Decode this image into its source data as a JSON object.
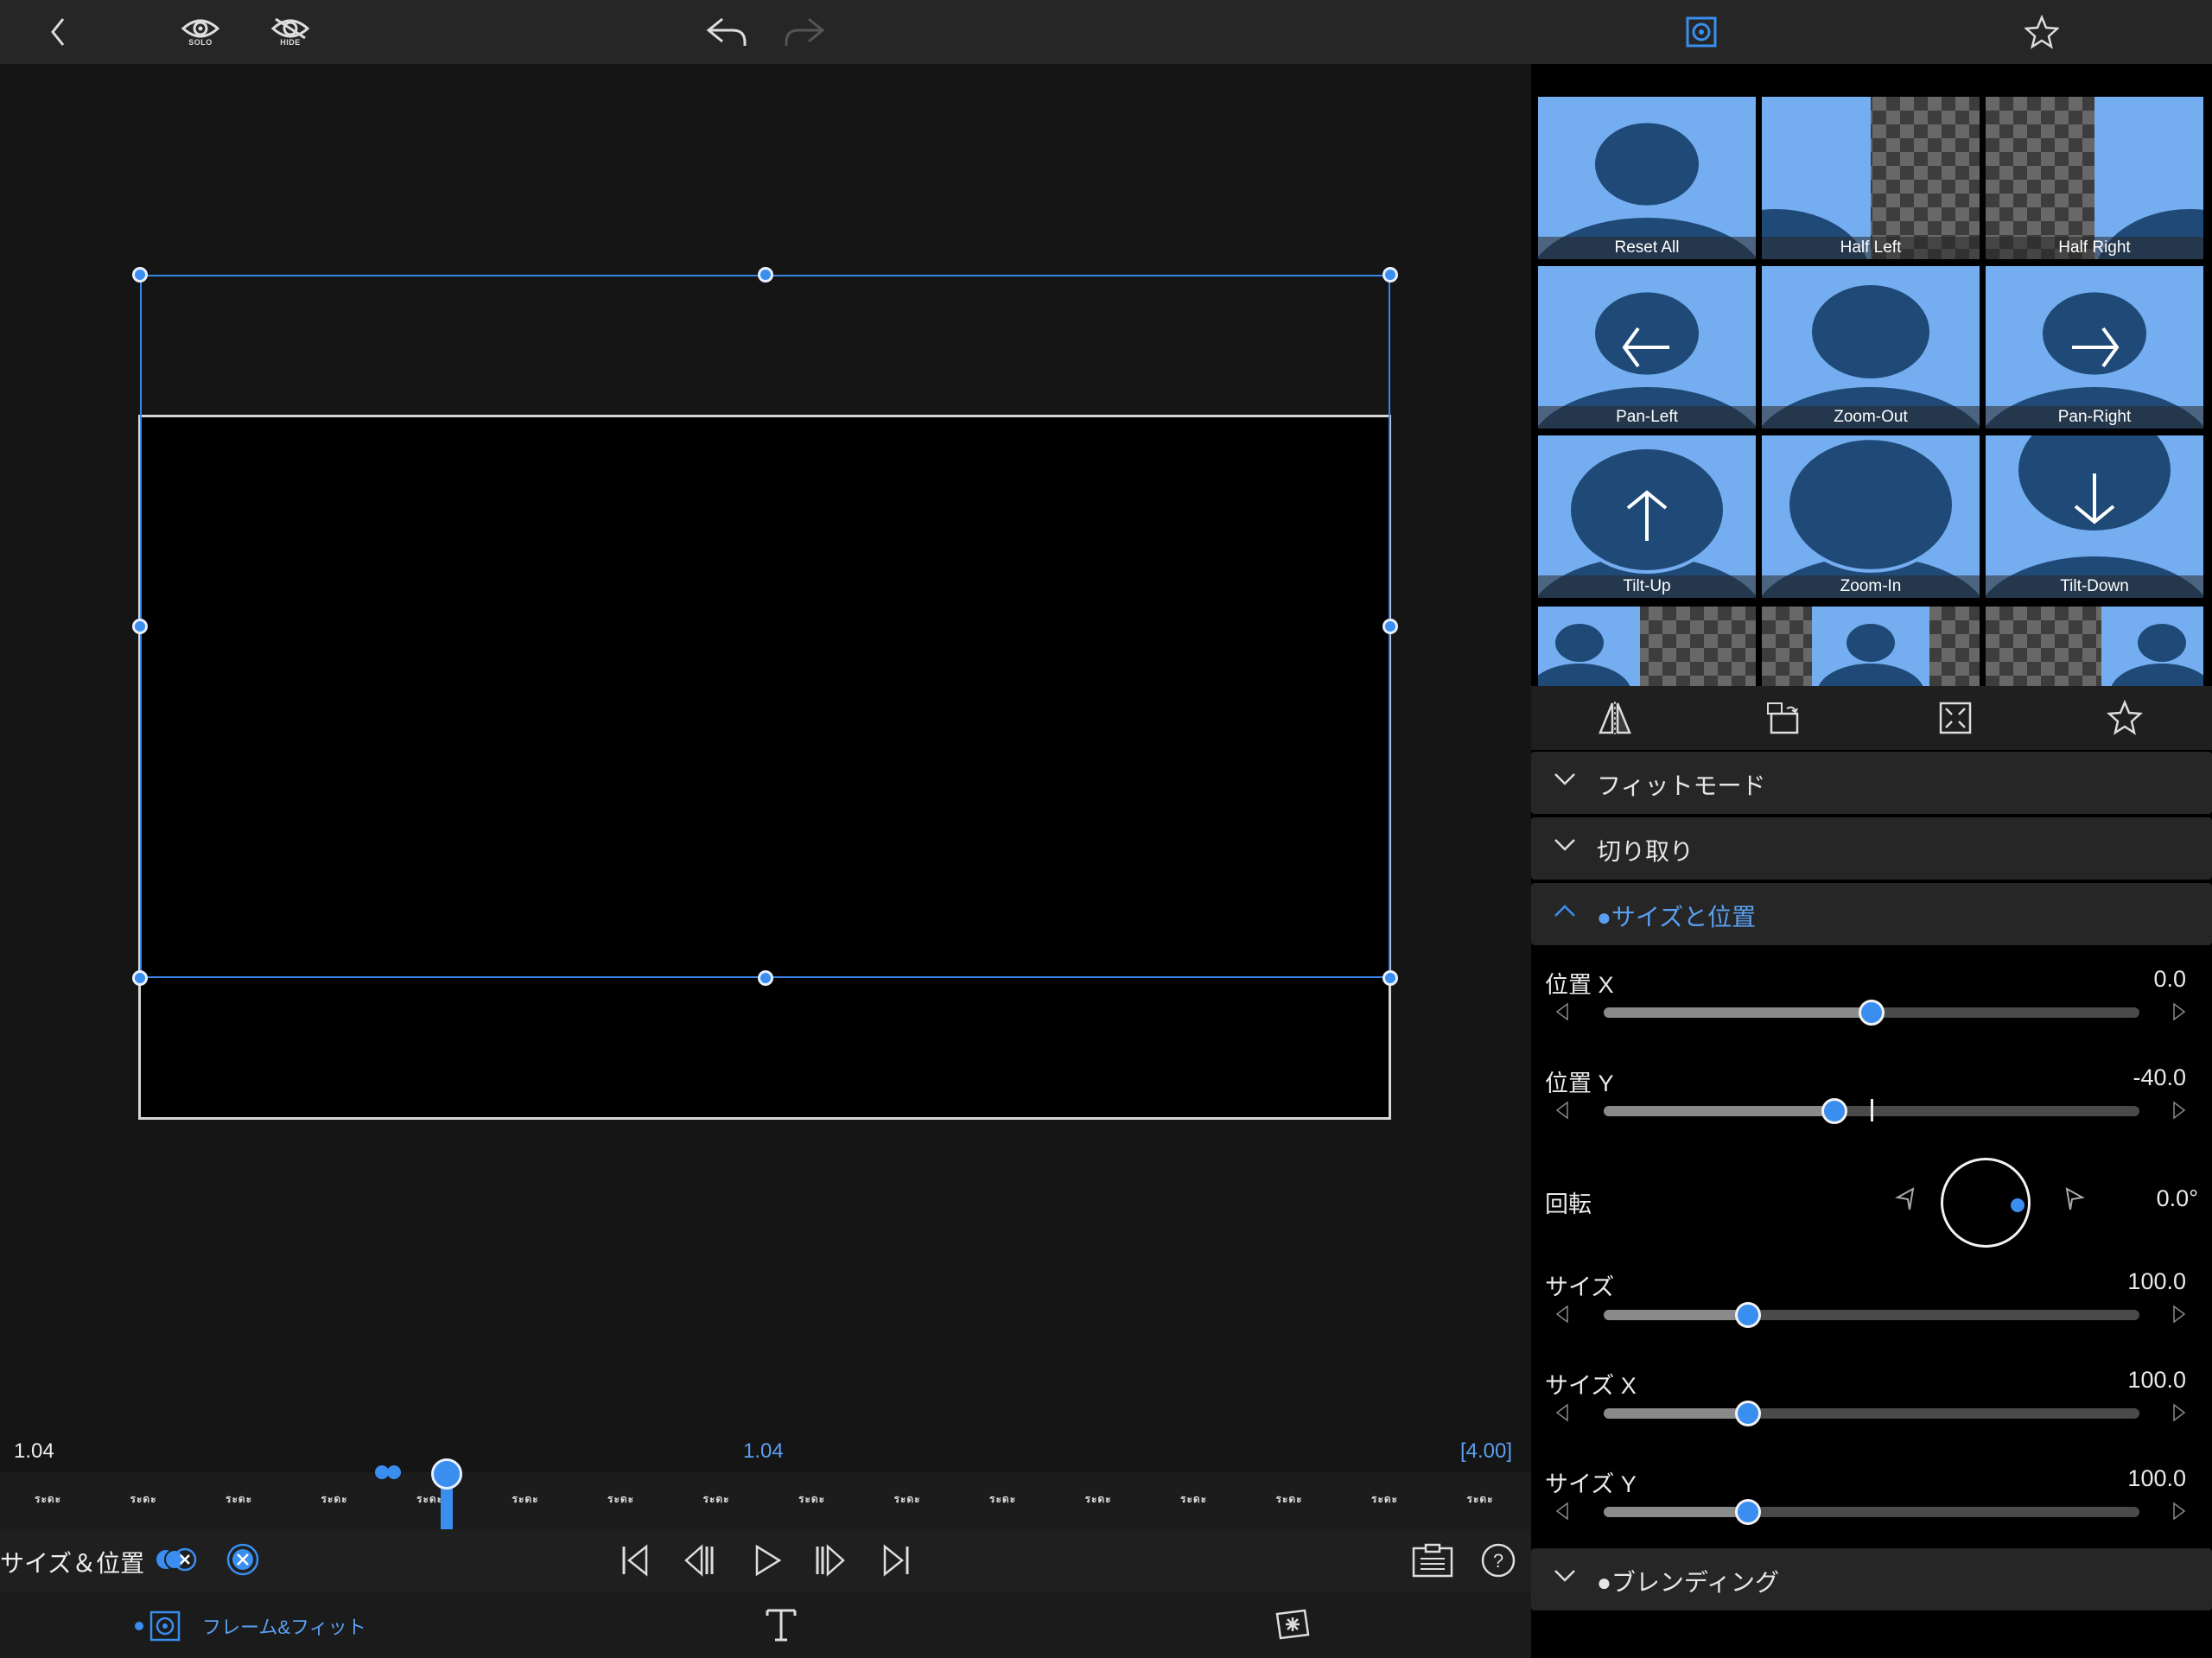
{
  "toolbar": {
    "solo_label": "SOLO",
    "hide_label": "HIDE",
    "icons": [
      "back-chevron-icon",
      "eye-icon",
      "eye-slash-icon",
      "undo-icon",
      "redo-icon",
      "frame-fit-icon",
      "star-icon"
    ]
  },
  "timeline": {
    "current_left": "1.04",
    "current_center": "1.04",
    "duration": "[4.00]",
    "tick_label": "ระดะ",
    "tick_count": 16
  },
  "transport": {
    "mode_label": "サイズ＆位置",
    "icons": [
      "keyframe-toggle-icon",
      "clear-icon",
      "go-start-icon",
      "prev-frame-icon",
      "play-icon",
      "next-frame-icon",
      "go-end-icon",
      "clipboard-icon",
      "help-icon"
    ]
  },
  "bottom_tabs": {
    "frame_fit": "フレーム&フィット",
    "text_icon": "text-icon",
    "effects_icon": "effects-icon"
  },
  "presets": [
    {
      "label": "Reset All"
    },
    {
      "label": "Half Left"
    },
    {
      "label": "Half Right"
    },
    {
      "label": "Pan-Left"
    },
    {
      "label": "Zoom-Out"
    },
    {
      "label": "Pan-Right"
    },
    {
      "label": "Tilt-Up"
    },
    {
      "label": "Zoom-In"
    },
    {
      "label": "Tilt-Down"
    }
  ],
  "sections": {
    "fit_mode": "フィットモード",
    "crop": "切り取り",
    "size_position": "●サイズと位置",
    "blending": "●ブレンディング"
  },
  "properties": {
    "pos_x": {
      "label": "位置 X",
      "value": "0.0",
      "fraction": 0.5
    },
    "pos_y": {
      "label": "位置 Y",
      "value": "-40.0",
      "fraction": 0.43
    },
    "rotation": {
      "label": "回転",
      "value": "0.0°"
    },
    "size": {
      "label": "サイズ",
      "value": "100.0",
      "fraction": 0.27
    },
    "size_x": {
      "label": "サイズ X",
      "value": "100.0",
      "fraction": 0.27
    },
    "size_y": {
      "label": "サイズ Y",
      "value": "100.0",
      "fraction": 0.27
    }
  },
  "colors": {
    "accent": "#3a8ef0",
    "preset_bg": "#75aef0",
    "preset_figure": "#1f4a78"
  }
}
